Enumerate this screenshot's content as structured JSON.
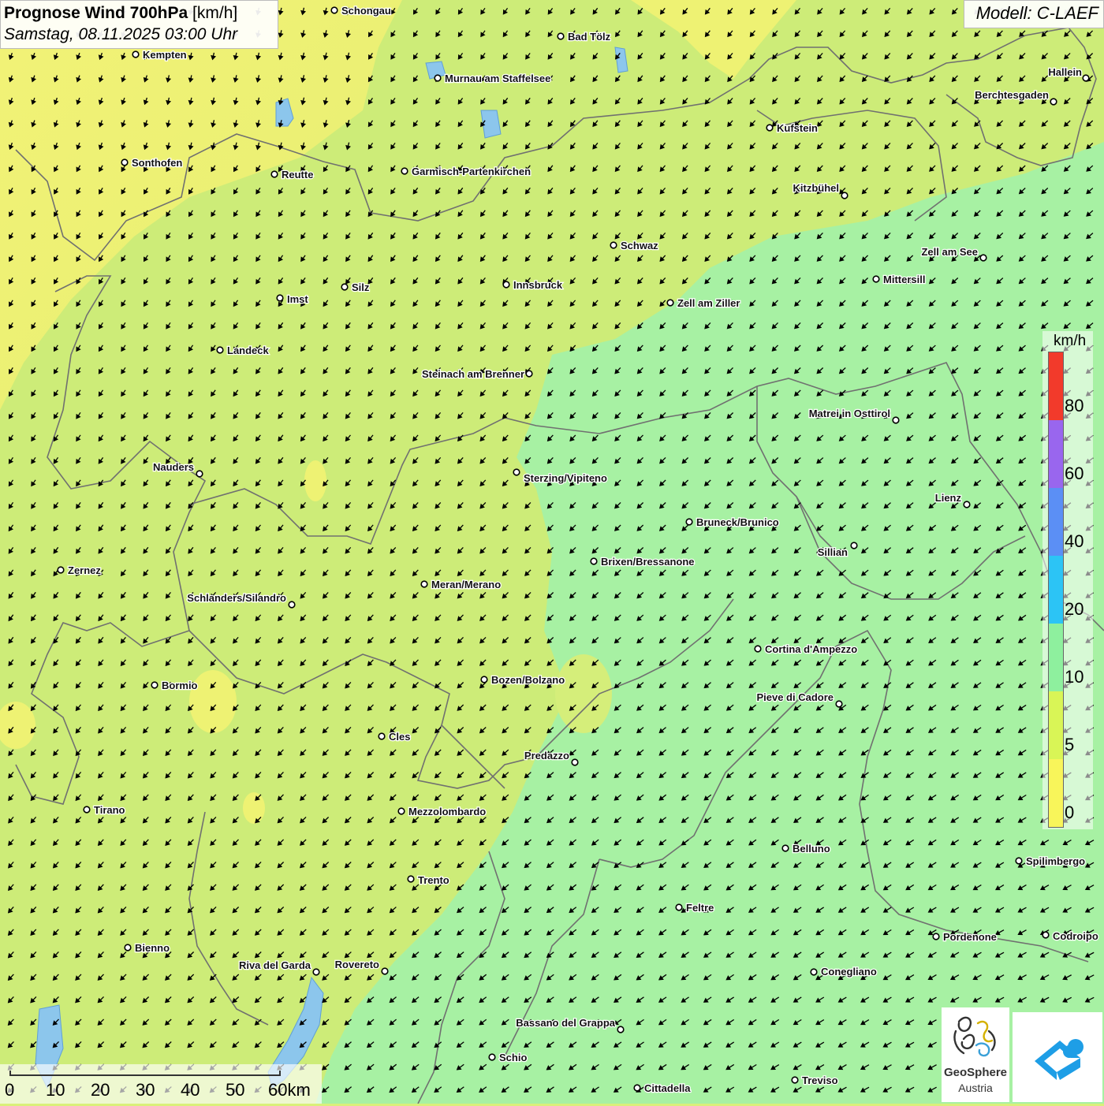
{
  "header": {
    "title": "Prognose Wind 700hPa",
    "unit": "[km/h]",
    "datetime": "Samstag, 08.11.2025 03:00 Uhr"
  },
  "model": {
    "label": "Modell: C-LAEF"
  },
  "legend": {
    "unit": "km/h",
    "labels": [
      "80",
      "60",
      "40",
      "20",
      "10",
      "5",
      "0"
    ],
    "colors": [
      "#f23a2b",
      "#9966ee",
      "#5b8ff5",
      "#2cc4f5",
      "#8ef09e",
      "#d9f556",
      "#f8f55a"
    ]
  },
  "scalebar": {
    "labels": [
      "0",
      "10",
      "20",
      "30",
      "40",
      "50",
      "60km"
    ]
  },
  "logos": {
    "geosphere_name": "GeoSphere",
    "geosphere_sub": "Austria",
    "geosphere_icon": "geosphere-logo-icon",
    "app_icon": "weather-app-logo-icon"
  },
  "map": {
    "colors": {
      "yellow": "#ecf274",
      "lightgreen": "#c9ec78",
      "green": "#a8f2a4",
      "border": "#6b6b6b",
      "water": "#7ab8e8"
    },
    "wind_arrow_icon": "wind-arrow-icon",
    "cities": [
      {
        "name": "Schongau"
      },
      {
        "name": "Bad Tölz"
      },
      {
        "name": "Kempten"
      },
      {
        "name": "Murnau am Staffelsee"
      },
      {
        "name": "Hallein"
      },
      {
        "name": "Berchtesgaden"
      },
      {
        "name": "Kufstein"
      },
      {
        "name": "Sonthofen"
      },
      {
        "name": "Reutte"
      },
      {
        "name": "Garmisch-Partenkirchen"
      },
      {
        "name": "Kitzbühel"
      },
      {
        "name": "Schwaz"
      },
      {
        "name": "Zell am See"
      },
      {
        "name": "Mittersill"
      },
      {
        "name": "Innsbruck"
      },
      {
        "name": "Silz"
      },
      {
        "name": "Imst"
      },
      {
        "name": "Zell am Ziller"
      },
      {
        "name": "Landeck"
      },
      {
        "name": "Steinach am Brenner"
      },
      {
        "name": "Matrei in Osttirol"
      },
      {
        "name": "Nauders"
      },
      {
        "name": "Sterzing/Vipiteno"
      },
      {
        "name": "Lienz"
      },
      {
        "name": "Bruneck/Brunico"
      },
      {
        "name": "Sillian"
      },
      {
        "name": "Brixen/Bressanone"
      },
      {
        "name": "Zernez"
      },
      {
        "name": "Meran/Merano"
      },
      {
        "name": "Schlanders/Silandro"
      },
      {
        "name": "Cortina d'Ampezzo"
      },
      {
        "name": "Bozen/Bolzano"
      },
      {
        "name": "Bormio"
      },
      {
        "name": "Pieve di Cadore"
      },
      {
        "name": "Cles"
      },
      {
        "name": "Predazzo"
      },
      {
        "name": "Tirano"
      },
      {
        "name": "Mezzolombardo"
      },
      {
        "name": "Belluno"
      },
      {
        "name": "Spilimbergo"
      },
      {
        "name": "Trento"
      },
      {
        "name": "Feltre"
      },
      {
        "name": "Pordenone"
      },
      {
        "name": "Codroipo"
      },
      {
        "name": "Bienno"
      },
      {
        "name": "Riva del Garda"
      },
      {
        "name": "Rovereto"
      },
      {
        "name": "Conegliano"
      },
      {
        "name": "Bassano del Grappa"
      },
      {
        "name": "Schio"
      },
      {
        "name": "Cittadella"
      },
      {
        "name": "Treviso"
      }
    ]
  }
}
